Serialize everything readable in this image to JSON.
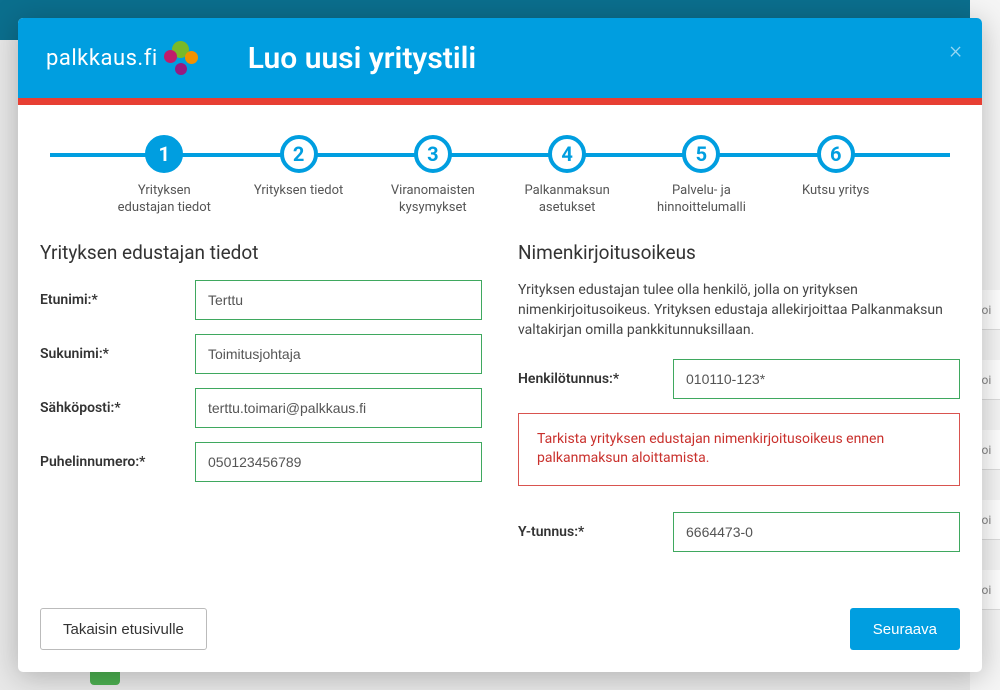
{
  "logo_text": "palkkaus.fi",
  "modal_title": "Luo uusi yritystili",
  "stepper": [
    {
      "num": "1",
      "label": "Yrityksen edustajan tiedot",
      "active": true
    },
    {
      "num": "2",
      "label": "Yrityksen tiedot",
      "active": false
    },
    {
      "num": "3",
      "label": "Viranomaisten kysymykset",
      "active": false
    },
    {
      "num": "4",
      "label": "Palkanmaksun asetukset",
      "active": false
    },
    {
      "num": "5",
      "label": "Palvelu- ja hinnoittelumalli",
      "active": false
    },
    {
      "num": "6",
      "label": "Kutsu yritys",
      "active": false
    }
  ],
  "left": {
    "section_title": "Yrityksen edustajan tiedot",
    "firstname_label": "Etunimi:*",
    "firstname_value": "Terttu",
    "lastname_label": "Sukunimi:*",
    "lastname_value": "Toimitusjohtaja",
    "email_label": "Sähköposti:*",
    "email_value": "terttu.toimari@palkkaus.fi",
    "phone_label": "Puhelinnumero:*",
    "phone_value": "050123456789"
  },
  "right": {
    "section_title": "Nimenkirjoitusoikeus",
    "info_text": "Yrityksen edustajan tulee olla henkilö, jolla on yrityksen nimenkirjoitusoikeus. Yrityksen edustaja allekirjoittaa Palkanmaksun valtakirjan omilla pankkitunnuksillaan.",
    "ssn_label": "Henkilötunnus:*",
    "ssn_value": "010110-123*",
    "warning_text": "Tarkista yrityksen edustajan nimenkirjoitusoikeus ennen palkanmaksun aloittamista.",
    "ytunnus_label": "Y-tunnus:*",
    "ytunnus_value": "6664473-0"
  },
  "footer": {
    "back_label": "Takaisin etusivulle",
    "next_label": "Seuraava"
  },
  "bg_row_text": "Poi"
}
